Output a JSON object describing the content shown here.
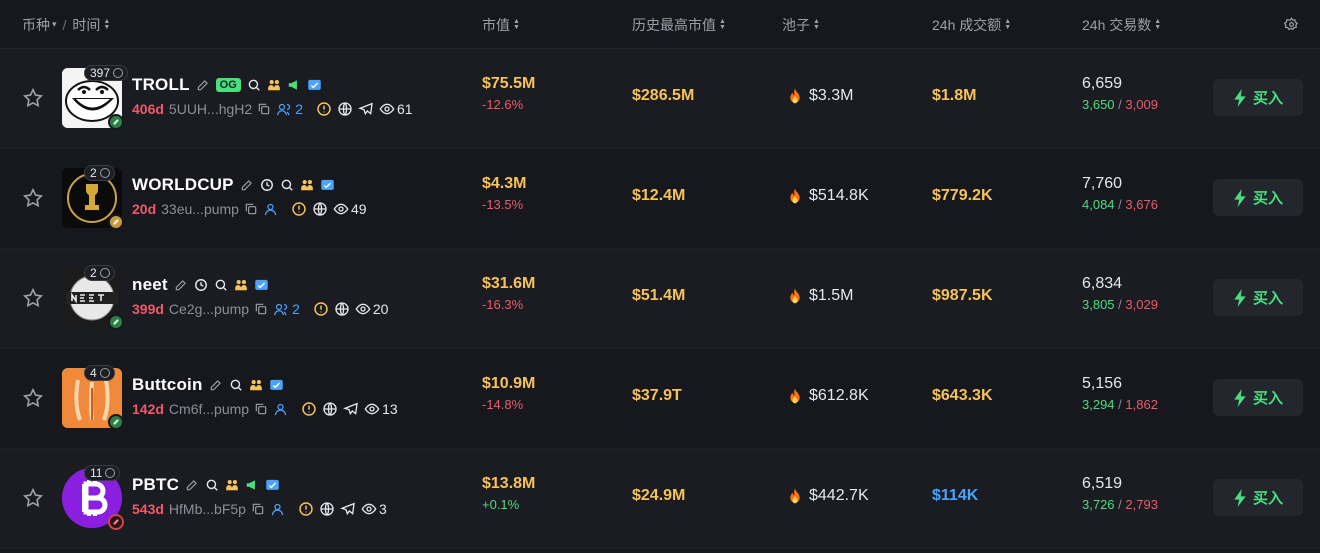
{
  "header": {
    "coin_label": "币种",
    "separator": "/",
    "time_label": "时间",
    "mcap_label": "市值",
    "ath_label": "历史最高市值",
    "pool_label": "池子",
    "vol_label": "24h 成交额",
    "tx_label": "24h 交易数",
    "settings_icon": "gear-icon"
  },
  "colors": {
    "background": "#16181d",
    "accent_yellow": "#f5c25b",
    "positive": "#4ade80",
    "negative": "#f0596b",
    "blue": "#4aa3ff"
  },
  "rows": [
    {
      "holders": "397",
      "name": "TROLL",
      "og": "OG",
      "age": "406d",
      "address": "5UUH...hgH2",
      "dev_count": "2",
      "views": "61",
      "mcap": "$75.5M",
      "change": "-12.6%",
      "ath": "$286.5M",
      "pool": "$3.3M",
      "volume": "$1.8M",
      "tx_total": "6,659",
      "buys": "3,650",
      "sells": "3,009",
      "buy_label": "买入"
    },
    {
      "holders": "2",
      "name": "WORLDCUP",
      "age": "20d",
      "address": "33eu...pump",
      "views": "49",
      "mcap": "$4.3M",
      "change": "-13.5%",
      "ath": "$12.4M",
      "pool": "$514.8K",
      "volume": "$779.2K",
      "tx_total": "7,760",
      "buys": "4,084",
      "sells": "3,676",
      "buy_label": "买入"
    },
    {
      "holders": "2",
      "name": "neet",
      "age": "399d",
      "address": "Ce2g...pump",
      "dev_count": "2",
      "views": "20",
      "mcap": "$31.6M",
      "change": "-16.3%",
      "ath": "$51.4M",
      "pool": "$1.5M",
      "volume": "$987.5K",
      "tx_total": "6,834",
      "buys": "3,805",
      "sells": "3,029",
      "buy_label": "买入"
    },
    {
      "holders": "4",
      "name": "Buttcoin",
      "age": "142d",
      "address": "Cm6f...pump",
      "views": "13",
      "mcap": "$10.9M",
      "change": "-14.8%",
      "ath": "$37.9T",
      "pool": "$612.8K",
      "volume": "$643.3K",
      "tx_total": "5,156",
      "buys": "3,294",
      "sells": "1,862",
      "buy_label": "买入"
    },
    {
      "holders": "11",
      "name": "PBTC",
      "age": "543d",
      "address": "HfMb...bF5p",
      "views": "3",
      "mcap": "$13.8M",
      "change": "+0.1%",
      "ath": "$24.9M",
      "pool": "$442.7K",
      "volume": "$114K",
      "tx_total": "6,519",
      "buys": "3,726",
      "sells": "2,793",
      "buy_label": "买入"
    }
  ]
}
